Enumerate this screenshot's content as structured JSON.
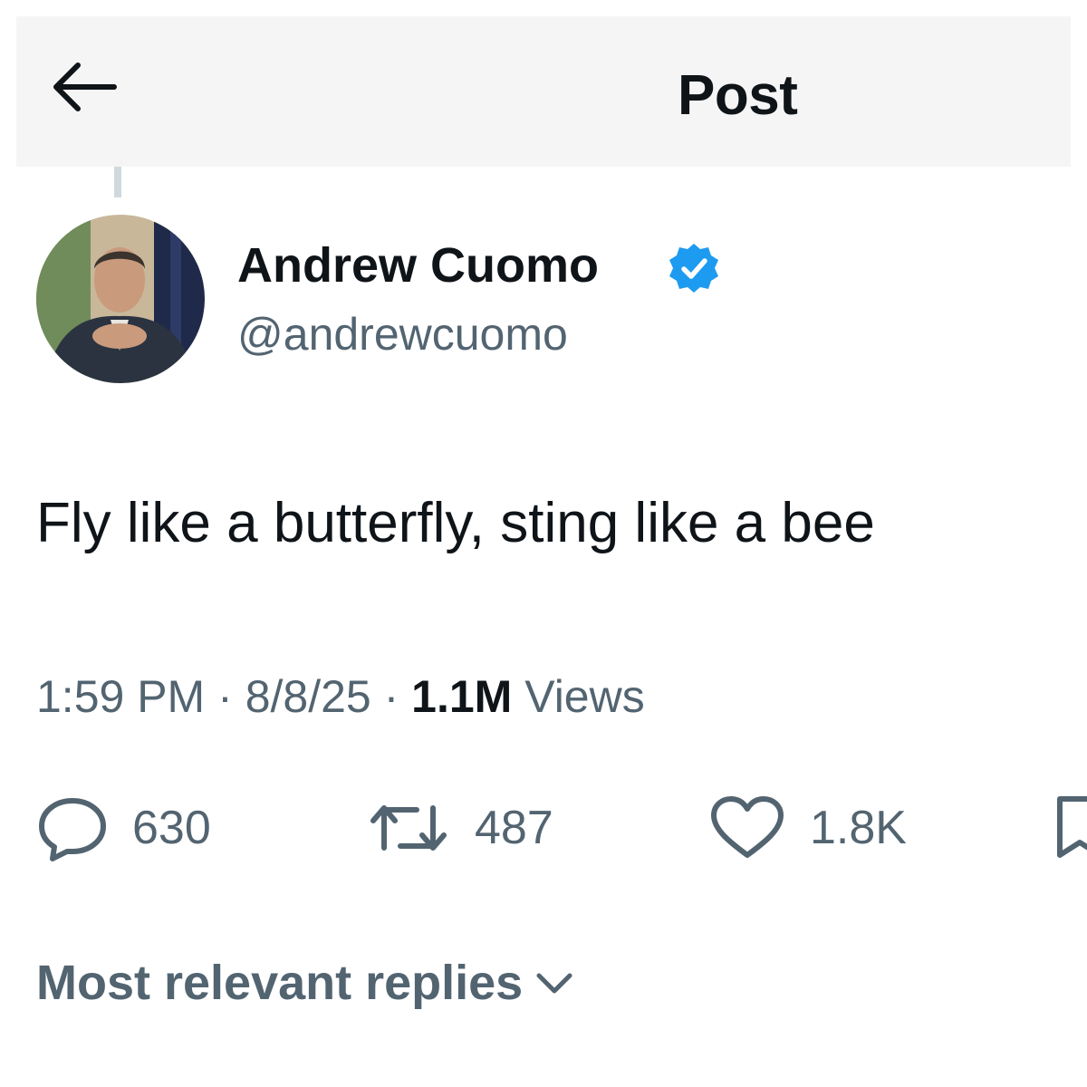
{
  "header": {
    "title": "Post",
    "back_icon": "arrow-left-icon"
  },
  "post": {
    "author": {
      "name": "Andrew Cuomo",
      "handle": "@andrewcuomo",
      "verified": true,
      "avatar_icon": "avatar-photo"
    },
    "text": "Fly like a butterfly, sting like a bee",
    "time": "1:59 PM",
    "date": "8/8/25",
    "separator": "·",
    "views_count": "1.1M",
    "views_label": "Views",
    "actions": {
      "replies": "630",
      "reposts": "487",
      "likes": "1.8K"
    }
  },
  "replies_sort": {
    "label": "Most relevant replies",
    "icon": "chevron-down-icon"
  },
  "colors": {
    "text_primary": "#0f1419",
    "text_secondary": "#536471",
    "verified_blue": "#1d9bf0",
    "header_bg": "#f5f5f5",
    "thread_line": "#cfd9de"
  }
}
